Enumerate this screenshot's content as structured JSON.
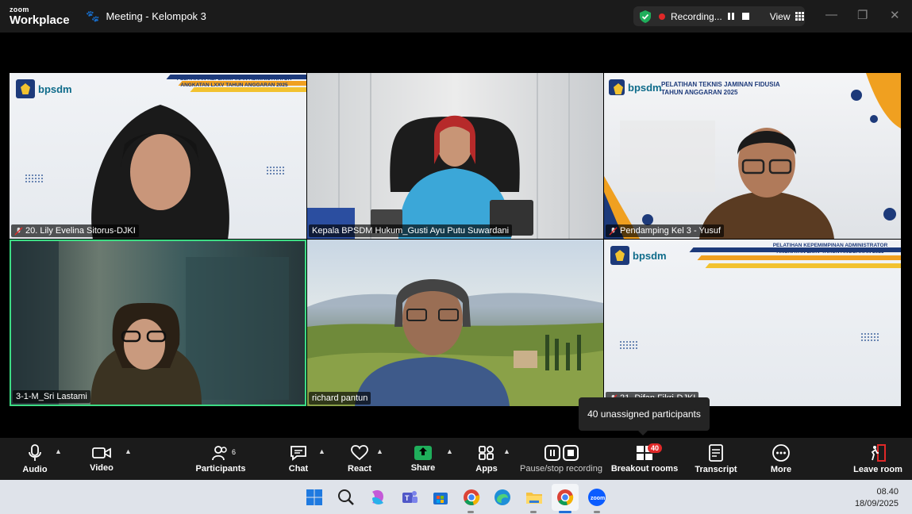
{
  "app": {
    "logo_line1": "zoom",
    "logo_line2": "Workplace"
  },
  "titlebar": {
    "meeting_title": "Meeting - Kelompok 3",
    "recording_label": "Recording...",
    "view_label": "View",
    "minimize": "—",
    "restore": "❐",
    "close": "✕"
  },
  "tiles": [
    {
      "name": "20. Lily Evelina Sitorus-DJKI",
      "muted": true,
      "banner": [
        "PELATIHAN KEPEMIMPINAN ADMINISTRATOR",
        "ANGKATAN LXXV TAHUN ANGGARAN 2025"
      ],
      "brand": "bpsdm"
    },
    {
      "name": "Kepala BPSDM Hukum_Gusti Ayu Putu Suwardani",
      "muted": false
    },
    {
      "name": "Pendamping Kel 3 - Yusuf",
      "muted": true,
      "banner": [
        "PELATIHAN TEKNIS JAMINAN FIDUSIA",
        "TAHUN ANGGARAN 2025"
      ],
      "brand": "bpsdm"
    },
    {
      "name": "3-1-M_Sri Lastami",
      "muted": false,
      "active_speaker": true
    },
    {
      "name": "richard pantun",
      "muted": false
    },
    {
      "name": "21. Difan Fikri-DJKI",
      "muted": true,
      "banner": [
        "PELATIHAN KEPEMIMPINAN ADMINISTRATOR",
        "ANGKATAN LXXV TAHUN ANGGARAN 2025"
      ],
      "brand": "bpsdm"
    }
  ],
  "tooltip": {
    "text": "40 unassigned participants"
  },
  "toolbar": {
    "audio": "Audio",
    "video": "Video",
    "participants": "Participants",
    "participants_count": "6",
    "chat": "Chat",
    "react": "React",
    "share": "Share",
    "apps": "Apps",
    "recording": "Pause/stop recording",
    "breakout": "Breakout rooms",
    "breakout_badge": "40",
    "transcript": "Transcript",
    "more": "More",
    "leave": "Leave room"
  },
  "colors": {
    "toolbar_bg": "#1b1b1b",
    "active_speaker_border": "#3ddc84",
    "recording_red": "#e02828",
    "share_green": "#1fae5b",
    "leave_red": "#e02828"
  },
  "taskbar": {
    "icons": [
      "windows-start",
      "search",
      "copilot",
      "teams",
      "microsoft-store",
      "chrome",
      "edge",
      "file-explorer",
      "chrome-active",
      "zoom"
    ],
    "time": "08.40",
    "date": "18/09/2025"
  }
}
